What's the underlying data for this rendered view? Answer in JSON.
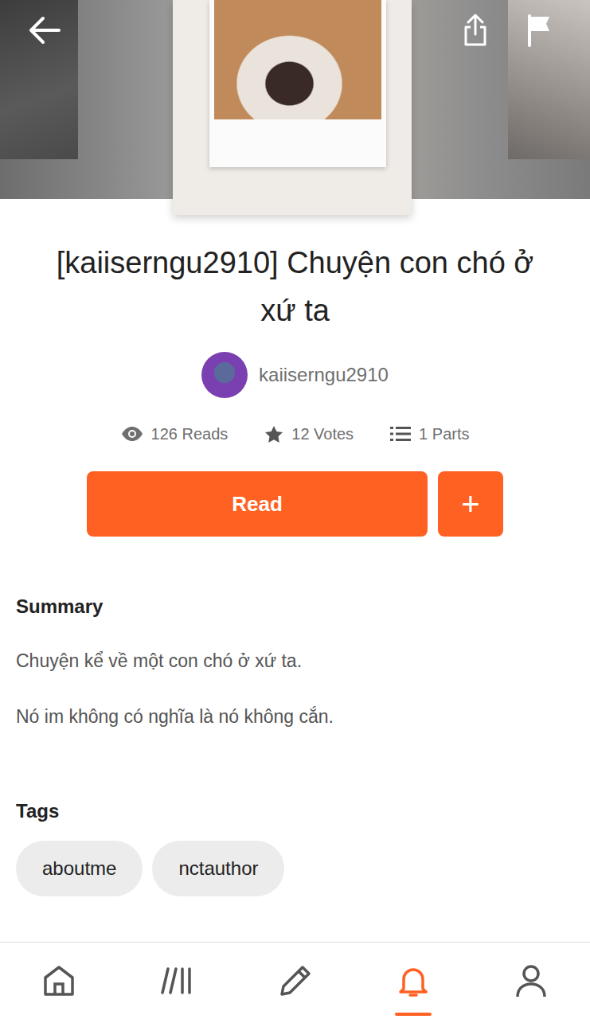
{
  "story": {
    "title": "[kaiiserngu2910] Chuyện con chó ở xứ ta",
    "author": "kaiiserngu2910",
    "stats": [
      {
        "kind": "eye",
        "text": "126 Reads"
      },
      {
        "kind": "star",
        "text": "12 Votes"
      },
      {
        "kind": "list",
        "text": "1 Parts"
      }
    ]
  },
  "actions": {
    "read": "Read",
    "add": "+"
  },
  "summary": {
    "heading": "Summary",
    "paragraphs": [
      "Chuyện kể về một con chó ở xứ ta.",
      "Nó im không có nghĩa là nó không cắn."
    ]
  },
  "tags": {
    "heading": "Tags",
    "items": [
      "aboutme",
      "nctauthor"
    ]
  },
  "bottom_nav": [
    {
      "kind": "home",
      "selected": false
    },
    {
      "kind": "library",
      "selected": false
    },
    {
      "kind": "write",
      "selected": false
    },
    {
      "kind": "notifications",
      "selected": true
    },
    {
      "kind": "profile",
      "selected": false
    }
  ]
}
